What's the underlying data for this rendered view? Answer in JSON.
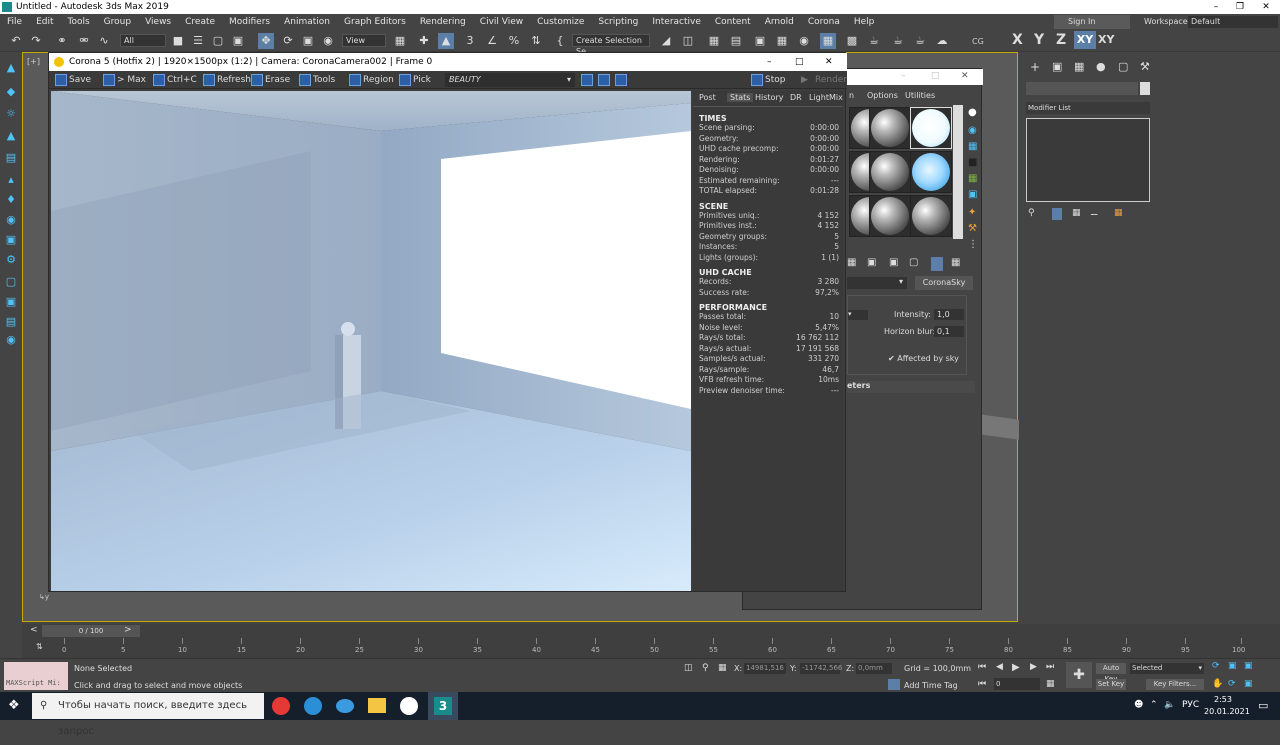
{
  "window": {
    "title": "Untitled - Autodesk 3ds Max 2019"
  },
  "menu": [
    "File",
    "Edit",
    "Tools",
    "Group",
    "Views",
    "Create",
    "Modifiers",
    "Animation",
    "Graph Editors",
    "Rendering",
    "Civil View",
    "Customize",
    "Scripting",
    "Interactive",
    "Content",
    "Arnold",
    "Corona",
    "Help"
  ],
  "account": {
    "signin": "Sign In",
    "workspaces_label": "Workspaces:",
    "workspace": "Default"
  },
  "toolbar": {
    "filter": "All",
    "view": "View",
    "selection_set": "Create Selection Se",
    "cg": "CG",
    "axes": [
      "X",
      "Y",
      "Z",
      "XY",
      "XY"
    ]
  },
  "vfb": {
    "title": "Corona 5 (Hotfix 2) | 1920×1500px (1:2) | Camera: CoronaCamera002 | Frame 0",
    "tools": [
      "Save",
      "> Max",
      "Ctrl+C",
      "Refresh",
      "Erase",
      "Tools",
      "Region",
      "Pick"
    ],
    "pass": "BEAUTY",
    "stop": "Stop",
    "render": "Render",
    "tabs": [
      "Post",
      "Stats",
      "History",
      "DR",
      "LightMix"
    ],
    "times": {
      "heading": "TIMES",
      "rows": [
        [
          "Scene parsing:",
          "0:00:00"
        ],
        [
          "Geometry:",
          "0:00:00"
        ],
        [
          "UHD cache precomp:",
          "0:00:00"
        ],
        [
          "Rendering:",
          "0:01:27"
        ],
        [
          "Denoising:",
          "0:00:00"
        ],
        [
          "Estimated remaining:",
          "---"
        ],
        [
          "TOTAL elapsed:",
          "0:01:28"
        ]
      ]
    },
    "scene": {
      "heading": "SCENE",
      "rows": [
        [
          "Primitives uniq.:",
          "4 152"
        ],
        [
          "Primitives inst.:",
          "4 152"
        ],
        [
          "Geometry groups:",
          "5"
        ],
        [
          "Instances:",
          "5"
        ],
        [
          "Lights (groups):",
          "1 (1)"
        ]
      ]
    },
    "uhd": {
      "heading": "UHD CACHE",
      "rows": [
        [
          "Records:",
          "3 280"
        ],
        [
          "Success rate:",
          "97,2%"
        ]
      ]
    },
    "perf": {
      "heading": "PERFORMANCE",
      "rows": [
        [
          "Passes total:",
          "10"
        ],
        [
          "Noise level:",
          "5,47%"
        ],
        [
          "Rays/s total:",
          "16 762 112"
        ],
        [
          "Rays/s actual:",
          "17 191 568"
        ],
        [
          "Samples/s actual:",
          "331 270"
        ],
        [
          "Rays/sample:",
          "46,7"
        ],
        [
          "VFB refresh time:",
          "10ms"
        ],
        [
          "Preview denoiser time:",
          "---"
        ]
      ]
    }
  },
  "mated": {
    "menu_options": "Options",
    "menu_utilities": "Utilities",
    "map_type": "CoronaSky",
    "intensity_label": "Intensity:",
    "intensity": "1,0",
    "horizon_label": "Horizon blur:",
    "horizon": "0,1",
    "affected": "Affected by sky",
    "rollout": "eters",
    "rollout_n": "n"
  },
  "cmd": {
    "modifier_list": "Modifier List"
  },
  "timeline": {
    "frame": "0 / 100",
    "ticks": [
      "0",
      "5",
      "10",
      "15",
      "20",
      "25",
      "30",
      "35",
      "40",
      "45",
      "50",
      "55",
      "60",
      "65",
      "70",
      "75",
      "80",
      "85",
      "90",
      "95",
      "100"
    ]
  },
  "status": {
    "script": "MAXScript Mi:",
    "none_selected": "None Selected",
    "hint": "Click and drag to select and move objects",
    "x_label": "X:",
    "x": "14981,516",
    "y_label": "Y:",
    "y": "-11742,566",
    "z_label": "Z:",
    "z": "0,0mm",
    "grid": "Grid = 100,0mm",
    "add_time_tag": "Add Time Tag",
    "auto_key": "Auto Key",
    "set_key": "Set Key",
    "selected": "Selected",
    "key_filters": "Key Filters...",
    "frame_field": "0"
  },
  "taskbar": {
    "search": "Чтобы начать поиск, введите здесь запрос",
    "lang": "РУС",
    "time": "2:53",
    "date": "20.01.2021"
  }
}
